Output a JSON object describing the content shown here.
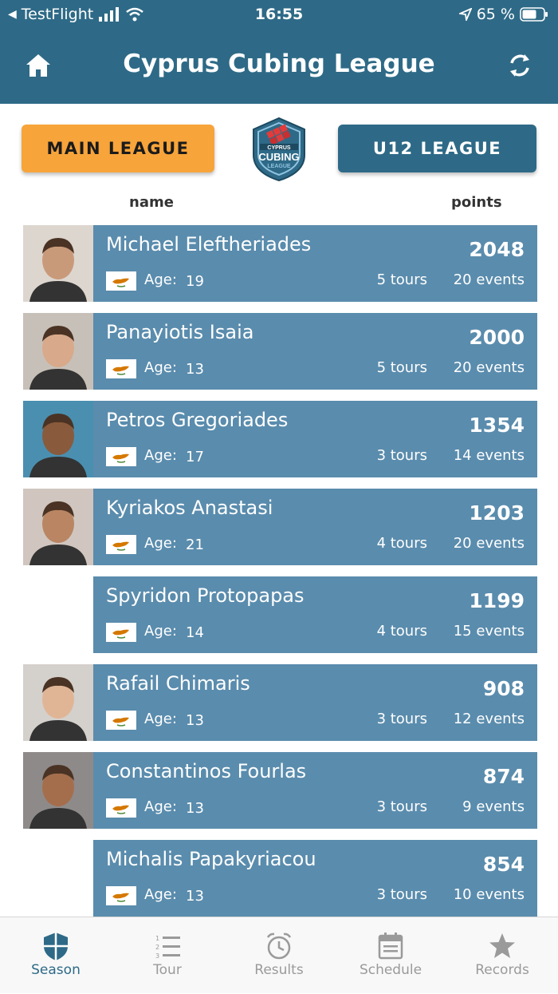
{
  "status_bar": {
    "back_app": "TestFlight",
    "time": "16:55",
    "battery": "65 %"
  },
  "header": {
    "title": "Cyprus Cubing League",
    "left_icon": "home-icon",
    "right_icon": "refresh-icon"
  },
  "league_buttons": {
    "main": "MAIN LEAGUE",
    "u12": "U12 LEAGUE"
  },
  "logo": {
    "line1": "CYPRUS",
    "line2": "CUBING",
    "line3": "LEAGUE"
  },
  "columns": {
    "name": "name",
    "points": "points"
  },
  "labels": {
    "age": "Age:"
  },
  "players": [
    {
      "name": "Michael Eleftheriades",
      "points": "2048",
      "age": "19",
      "tours": "5 tours",
      "events": "20 events",
      "has_photo": true
    },
    {
      "name": "Panayiotis Isaia",
      "points": "2000",
      "age": "13",
      "tours": "5 tours",
      "events": "20 events",
      "has_photo": true
    },
    {
      "name": "Petros Gregoriades",
      "points": "1354",
      "age": "17",
      "tours": "3 tours",
      "events": "14 events",
      "has_photo": true
    },
    {
      "name": "Kyriakos Anastasi",
      "points": "1203",
      "age": "21",
      "tours": "4 tours",
      "events": "20 events",
      "has_photo": true
    },
    {
      "name": "Spyridon Protopapas",
      "points": "1199",
      "age": "14",
      "tours": "4 tours",
      "events": "15 events",
      "has_photo": false
    },
    {
      "name": "Rafail Chimaris",
      "points": "908",
      "age": "13",
      "tours": "3 tours",
      "events": "12 events",
      "has_photo": true
    },
    {
      "name": "Constantinos Fourlas",
      "points": "874",
      "age": "13",
      "tours": "3 tours",
      "events": "9 events",
      "has_photo": true
    },
    {
      "name": "Michalis Papakyriacou",
      "points": "854",
      "age": "13",
      "tours": "3 tours",
      "events": "10 events",
      "has_photo": false
    }
  ],
  "tabs": [
    {
      "label": "Season",
      "icon": "shield-icon",
      "active": true
    },
    {
      "label": "Tour",
      "icon": "list-icon",
      "active": false
    },
    {
      "label": "Results",
      "icon": "alarm-clock-icon",
      "active": false
    },
    {
      "label": "Schedule",
      "icon": "calendar-icon",
      "active": false
    },
    {
      "label": "Records",
      "icon": "star-icon",
      "active": false
    }
  ],
  "colors": {
    "primary": "#2e6a87",
    "card": "#5a8cad",
    "accent": "#f7a43a"
  }
}
